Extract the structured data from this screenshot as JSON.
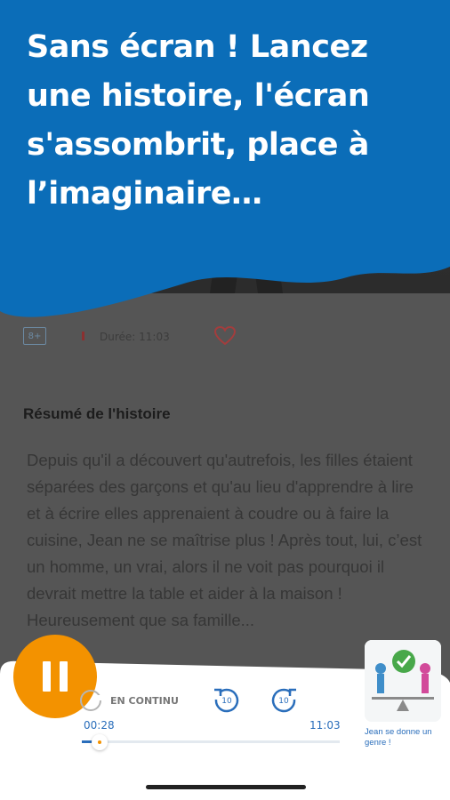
{
  "banner": {
    "line1": "Sans écran ! Lancez",
    "line2": "une histoire, l'écran",
    "line3": "s'assombrit, place à",
    "line4": "l’imaginaire…",
    "color": "#0b6db8"
  },
  "story": {
    "age": "8+",
    "duration": "Durée: 11:03",
    "summary_title": "Résumé de l'histoire",
    "summary": "Depuis qu'il a découvert qu'autrefois, les filles étaient séparées des garçons et qu'au lieu d'apprendre à lire et à écrire elles apprenaient à coudre ou à faire la cuisine, Jean ne se maîtrise plus ! Après tout, lui, c’est un homme, un vrai, alors il ne voit pas pourquoi il devrait mettre la table et aider à la maison ! Heureusement que sa famille..."
  },
  "player": {
    "continuous_label": "EN CONTINU",
    "skip_back": "10",
    "skip_forward": "10",
    "current_time": "00:28",
    "total_time": "11:03",
    "progress": 0.042,
    "accent_color": "#f39200",
    "caption": "Jean se donne un genre !"
  },
  "icons": {
    "pause": "pause-icon",
    "loop": "loop-icon",
    "back": "rewind-10-icon",
    "forward": "forward-10-icon",
    "heart": "heart-icon"
  }
}
